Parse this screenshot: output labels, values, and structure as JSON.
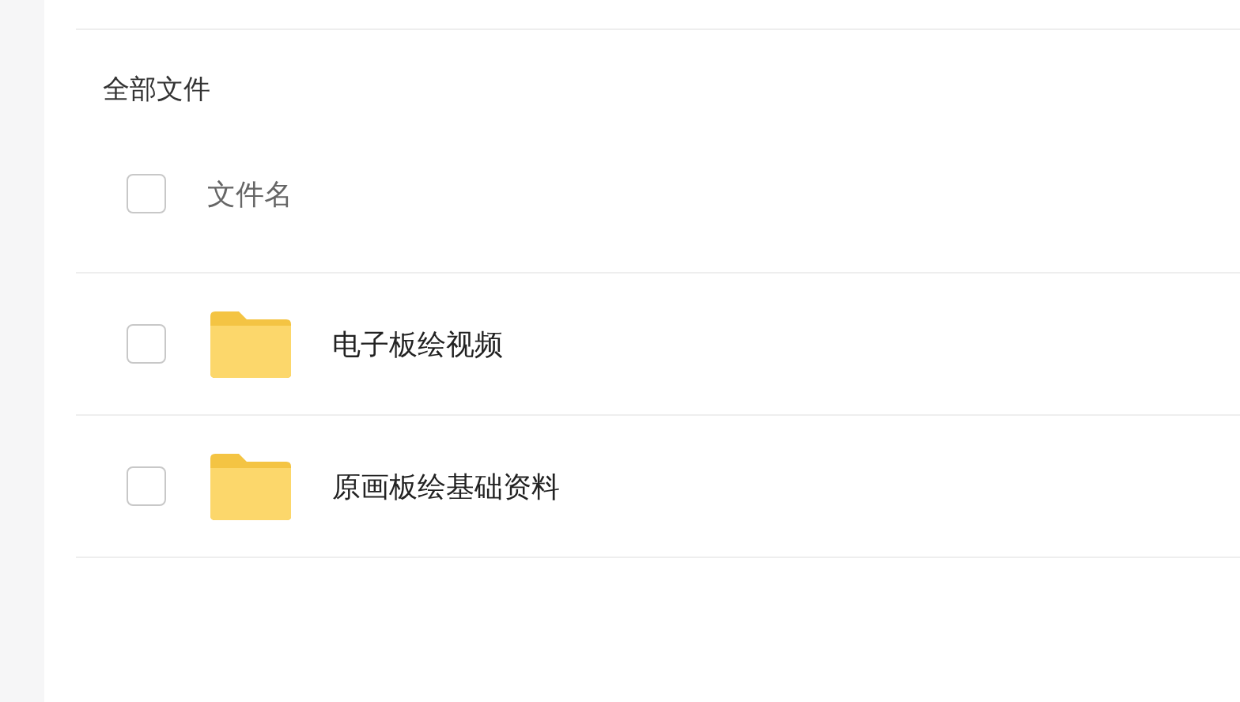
{
  "breadcrumb": "全部文件",
  "header": {
    "checked": false,
    "label": "文件名"
  },
  "rows": [
    {
      "name": "电子板绘视频",
      "kind": "folder",
      "checked": false
    },
    {
      "name": "原画板绘基础资料",
      "kind": "folder",
      "checked": false
    }
  ]
}
